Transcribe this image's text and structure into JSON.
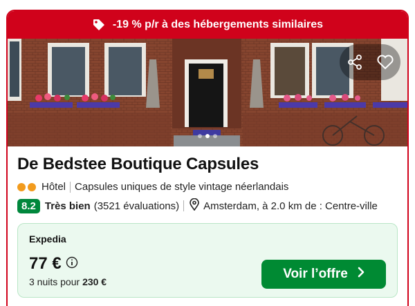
{
  "banner": {
    "text": "-19 % p/r à des hébergements similaires",
    "icon": "tag-icon"
  },
  "photo": {
    "dots_total": 3,
    "active_dot": 1,
    "actions": [
      "share-icon",
      "heart-icon"
    ]
  },
  "hotel": {
    "name": "De Bedstee Boutique Capsules",
    "stars": 2,
    "type": "Hôtel",
    "description": "Capsules uniques de style vintage néerlandais"
  },
  "rating": {
    "score": "8.2",
    "label": "Très bien",
    "reviews": "(3521 évaluations)",
    "location": "Amsterdam, à 2.0 km de : Centre-ville"
  },
  "deal": {
    "provider": "Expedia",
    "price": "77 €",
    "nights_text": "3 nuits pour",
    "total": "230 €",
    "cta_label": "Voir l’offre"
  },
  "colors": {
    "brand_red": "#d0021b",
    "score_green": "#00873c",
    "cta_green": "#008a33",
    "star_orange": "#f29b1d",
    "deal_bg": "#ebf9ef"
  }
}
